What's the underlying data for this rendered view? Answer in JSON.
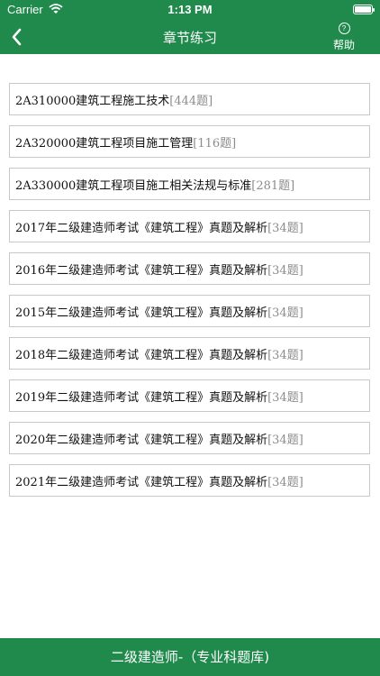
{
  "status": {
    "carrier": "Carrier",
    "time": "1:13 PM"
  },
  "nav": {
    "title": "章节练习",
    "help_label": "帮助",
    "help_glyph": "?"
  },
  "colors": {
    "primary": "#1f8a4c",
    "border": "#c8c8c8",
    "muted": "#8c8c8c"
  },
  "chapters": [
    {
      "title": "2A310000建筑工程施工技术",
      "count": "[444题]"
    },
    {
      "title": "2A320000建筑工程项目施工管理",
      "count": "[116题]"
    },
    {
      "title": "2A330000建筑工程项目施工相关法规与标准",
      "count": "[281题]"
    },
    {
      "title": "2017年二级建造师考试《建筑工程》真题及解析",
      "count": "[34题]"
    },
    {
      "title": "2016年二级建造师考试《建筑工程》真题及解析",
      "count": "[34题]"
    },
    {
      "title": "2015年二级建造师考试《建筑工程》真题及解析",
      "count": "[34题]"
    },
    {
      "title": "2018年二级建造师考试《建筑工程》真题及解析",
      "count": "[34题]"
    },
    {
      "title": "2019年二级建造师考试《建筑工程》真题及解析",
      "count": "[34题]"
    },
    {
      "title": "2020年二级建造师考试《建筑工程》真题及解析",
      "count": "[34题]"
    },
    {
      "title": "2021年二级建造师考试《建筑工程》真题及解析",
      "count": "[34题]"
    }
  ],
  "footer": {
    "label": "二级建造师-（专业科题库)"
  }
}
